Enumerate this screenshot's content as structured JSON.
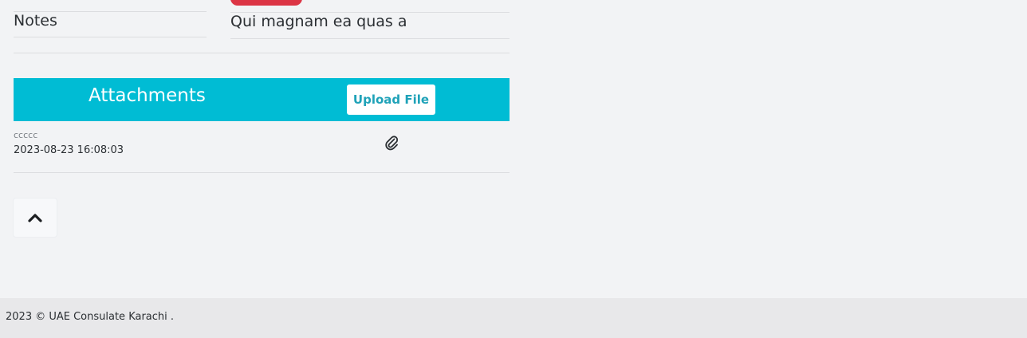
{
  "notes": {
    "label": "Notes",
    "value": "Qui magnam ea quas a"
  },
  "attachments": {
    "title": "Attachments",
    "upload_label": "Upload File",
    "files": [
      {
        "name": "ccccc",
        "date": "2023-08-23 16:08:03",
        "icon": "paperclip-icon"
      }
    ]
  },
  "scroll_top": {
    "icon": "chevron-up-icon"
  },
  "footer": {
    "text": "2023 © UAE Consulate Karachi ."
  },
  "colors": {
    "accent": "#00bcd4",
    "danger": "#dc3545",
    "background": "#f2f3f5",
    "footer_bg": "#e8e8ea"
  }
}
